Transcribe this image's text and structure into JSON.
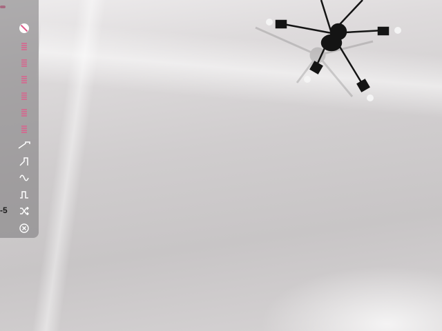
{
  "toolbar": {
    "accent_color": "#e05a8a",
    "icon_color": "#ffffff",
    "buttons": [
      {
        "icon": "prohibit-icon"
      },
      {
        "icon": "menu-lines-icon"
      },
      {
        "icon": "menu-lines-icon"
      },
      {
        "icon": "menu-lines-icon"
      },
      {
        "icon": "menu-lines-icon"
      },
      {
        "icon": "menu-lines-icon"
      },
      {
        "icon": "menu-lines-icon"
      },
      {
        "icon": "sawtooth-wave-icon"
      },
      {
        "icon": "ramp-wave-icon"
      },
      {
        "icon": "sine-wave-icon"
      },
      {
        "icon": "square-wave-icon"
      },
      {
        "icon": "shuffle-icon"
      },
      {
        "icon": "cancel-circle-icon"
      }
    ]
  },
  "side_value": "-5"
}
